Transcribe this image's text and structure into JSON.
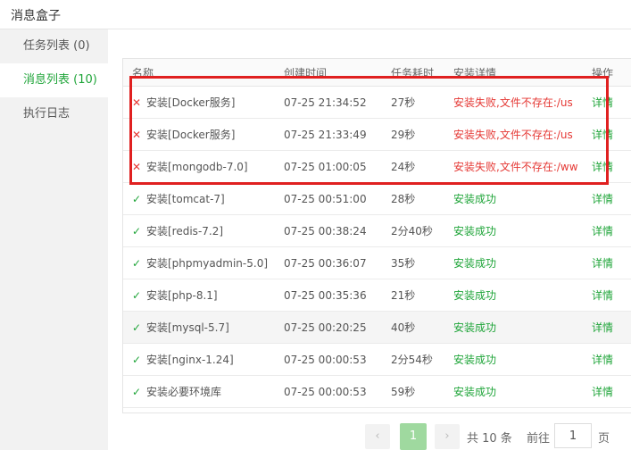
{
  "window": {
    "title": "消息盒子"
  },
  "sidebar": {
    "items": [
      {
        "label": "任务列表 (0)"
      },
      {
        "label": "消息列表 (10)"
      },
      {
        "label": "执行日志"
      }
    ]
  },
  "table": {
    "headers": [
      "名称",
      "创建时间",
      "任务耗时",
      "安装详情",
      "操作"
    ],
    "rows": [
      {
        "status": "fail",
        "name": "安装[Docker服务]",
        "time": "07-25 21:34:52",
        "duration": "27秒",
        "detail": "安装失败,文件不存在:/us",
        "action": "详情"
      },
      {
        "status": "fail",
        "name": "安装[Docker服务]",
        "time": "07-25 21:33:49",
        "duration": "29秒",
        "detail": "安装失败,文件不存在:/us",
        "action": "详情"
      },
      {
        "status": "fail",
        "name": "安装[mongodb-7.0]",
        "time": "07-25 01:00:05",
        "duration": "24秒",
        "detail": "安装失败,文件不存在:/ww",
        "action": "详情"
      },
      {
        "status": "ok",
        "name": "安装[tomcat-7]",
        "time": "07-25 00:51:00",
        "duration": "28秒",
        "detail": "安装成功",
        "action": "详情"
      },
      {
        "status": "ok",
        "name": "安装[redis-7.2]",
        "time": "07-25 00:38:24",
        "duration": "2分40秒",
        "detail": "安装成功",
        "action": "详情"
      },
      {
        "status": "ok",
        "name": "安装[phpmyadmin-5.0]",
        "time": "07-25 00:36:07",
        "duration": "35秒",
        "detail": "安装成功",
        "action": "详情"
      },
      {
        "status": "ok",
        "name": "安装[php-8.1]",
        "time": "07-25 00:35:36",
        "duration": "21秒",
        "detail": "安装成功",
        "action": "详情"
      },
      {
        "status": "ok",
        "name": "安装[mysql-5.7]",
        "time": "07-25 00:20:25",
        "duration": "40秒",
        "detail": "安装成功",
        "action": "详情"
      },
      {
        "status": "ok",
        "name": "安装[nginx-1.24]",
        "time": "07-25 00:00:53",
        "duration": "2分54秒",
        "detail": "安装成功",
        "action": "详情"
      },
      {
        "status": "ok",
        "name": "安装必要环境库",
        "time": "07-25 00:00:53",
        "duration": "59秒",
        "detail": "安装成功",
        "action": "详情"
      }
    ]
  },
  "pagination": {
    "prev": "‹",
    "current": "1",
    "next": "›",
    "total_text": "共 10 条",
    "goto_label": "前往",
    "goto_value": "1",
    "page_suffix": "页"
  },
  "icons": {
    "fail": "close-icon",
    "ok": "check-icon"
  },
  "colors": {
    "accent": "#20a53a",
    "error": "#e53935",
    "highlight": "#e02020"
  }
}
